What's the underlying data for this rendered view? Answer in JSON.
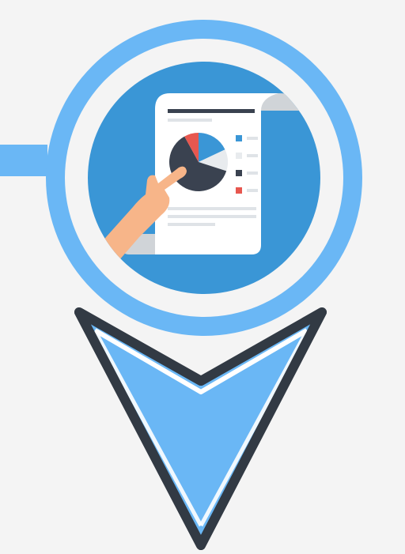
{
  "colors": {
    "background": "#f4f4f4",
    "ring": "#6ab7f5",
    "inner_circle": "#3a96d6",
    "arrow_fill": "#6ab7f5",
    "arrow_outline": "#323a44",
    "arrow_inner_line": "#ffffff",
    "paper": "#ffffff",
    "paper_shadow": "#d0d4d8",
    "text_lines": "#dfe3e7",
    "heading_line": "#3a4250",
    "pie_dark": "#3a4250",
    "pie_blue": "#3a96d6",
    "pie_red": "#e7574f",
    "pie_light": "#e8ebee",
    "hand": "#f7b589",
    "sleeve": "#f2f2f2"
  },
  "icons": {
    "pin": "map-pin-icon",
    "report": "report-document-icon",
    "pie": "pie-chart-icon",
    "hand": "hand-icon",
    "arrow": "arrow-down-icon",
    "connector": "connector-bar-icon"
  },
  "chart_data": {
    "type": "pie",
    "values": [
      0.18,
      0.12,
      0.62,
      0.08
    ],
    "colors": [
      "#3a96d6",
      "#e8ebee",
      "#3a4250",
      "#e7574f"
    ],
    "legend": [
      "#3a96d6",
      "#e8ebee",
      "#3a4250",
      "#e7574f"
    ]
  }
}
